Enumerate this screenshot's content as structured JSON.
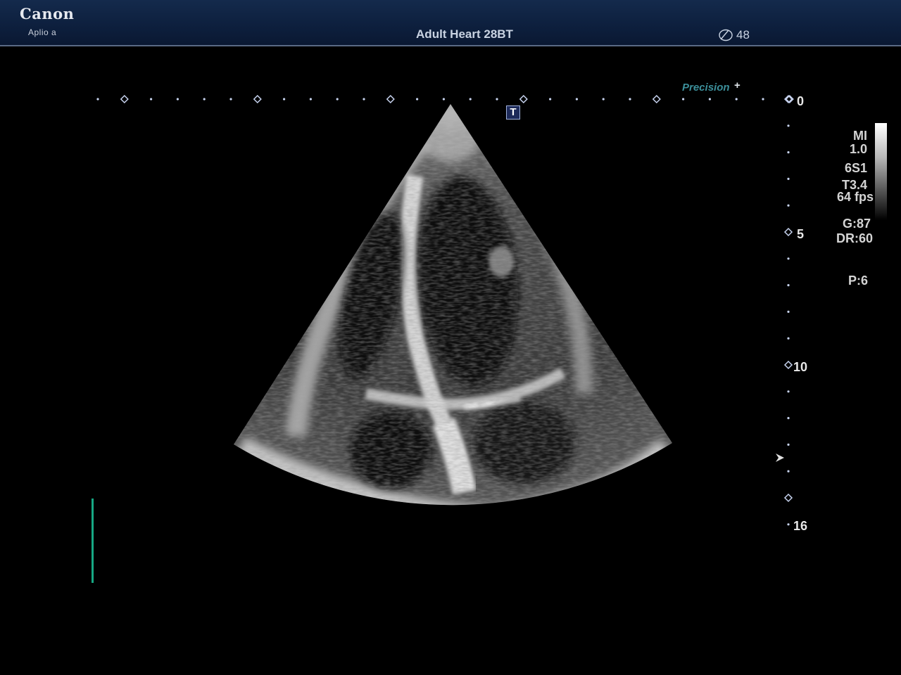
{
  "header": {
    "brand": "Canon",
    "model": "Aplio a",
    "preset": "Adult Heart 28BT",
    "frame_counter": "48",
    "counter_icon": "cine-loop-icon"
  },
  "image": {
    "enhancement_label": "Precision",
    "enhancement_suffix": "+",
    "transducer_marker": "T",
    "view": "apical four-chamber echocardiogram"
  },
  "depth_scale": {
    "labels": [
      "0",
      "5",
      "10",
      "16"
    ]
  },
  "parameters": {
    "mi_label": "MI",
    "mi_value": "1.0",
    "probe": "6S1",
    "thermal": "T3.4",
    "frame_rate": "64 fps",
    "gain": "G:87",
    "dynamic_range": "DR:60",
    "power": "P:6"
  },
  "colors": {
    "header_bg": "#0d1f3d",
    "accent_precision": "#3c8f9a",
    "ecg_green": "#17a884",
    "scale_marker": "#c8d4f0"
  }
}
